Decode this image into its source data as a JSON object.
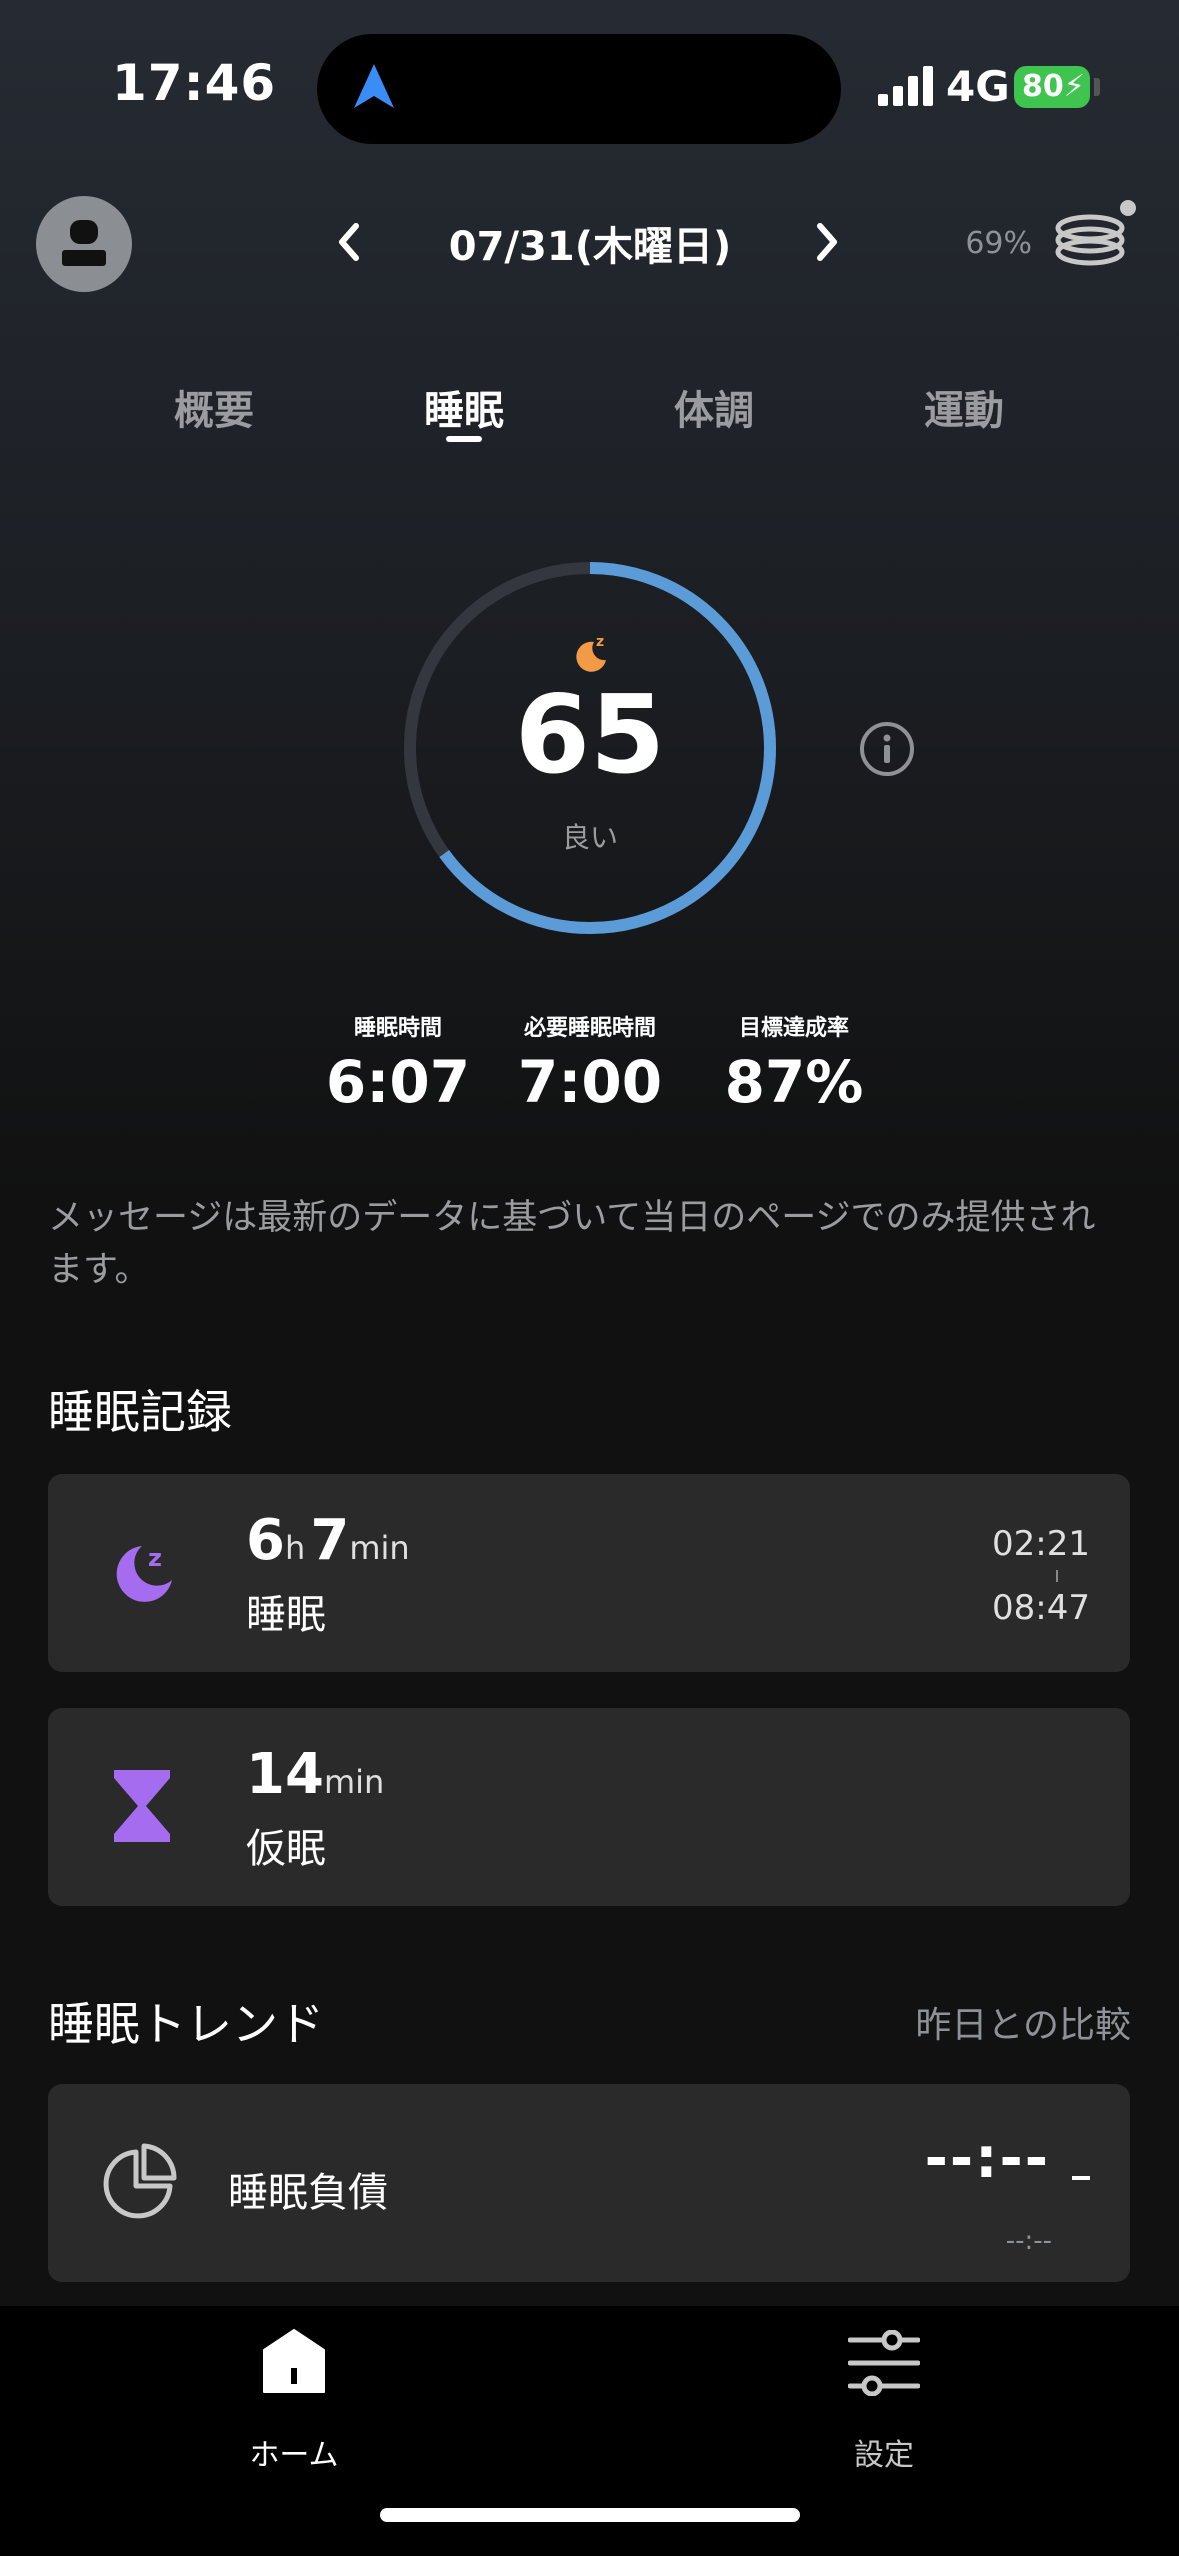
{
  "status_bar": {
    "time": "17:46",
    "network": "4G",
    "battery": "80"
  },
  "header": {
    "date": "07/31(木曜日)",
    "ring_battery": "69%"
  },
  "tabs": [
    {
      "label": "概要",
      "active": false
    },
    {
      "label": "睡眠",
      "active": true
    },
    {
      "label": "体調",
      "active": false
    },
    {
      "label": "運動",
      "active": false
    }
  ],
  "score": {
    "value": "65",
    "label": "良い",
    "progress": 0.65,
    "ring_color": "#5b9bd8"
  },
  "stats": [
    {
      "label": "睡眠時間",
      "value": "6:07"
    },
    {
      "label": "必要睡眠時間",
      "value": "7:00"
    },
    {
      "label": "目標達成率",
      "value": "87%"
    }
  ],
  "message": "メッセージは最新のデータに基づいて当日のページでのみ提供されます。",
  "sleep_record": {
    "title": "睡眠記録",
    "sleep": {
      "hours": "6",
      "hours_unit": "h",
      "minutes": "7",
      "minutes_unit": "min",
      "label": "睡眠",
      "start": "02:21",
      "end": "08:47"
    },
    "nap": {
      "minutes": "14",
      "minutes_unit": "min",
      "label": "仮眠"
    }
  },
  "sleep_trend": {
    "title": "睡眠トレンド",
    "compare_label": "昨日との比較",
    "debt": {
      "label": "睡眠負債",
      "value": "--:--",
      "sub": "--:--"
    }
  },
  "bottom_nav": [
    {
      "label": "ホーム",
      "active": true
    },
    {
      "label": "設定",
      "active": false
    }
  ],
  "colors": {
    "accent_blue": "#5b9bd8",
    "purple": "#a56cf0",
    "orange": "#f29a45",
    "battery_green": "#3ec44f"
  }
}
